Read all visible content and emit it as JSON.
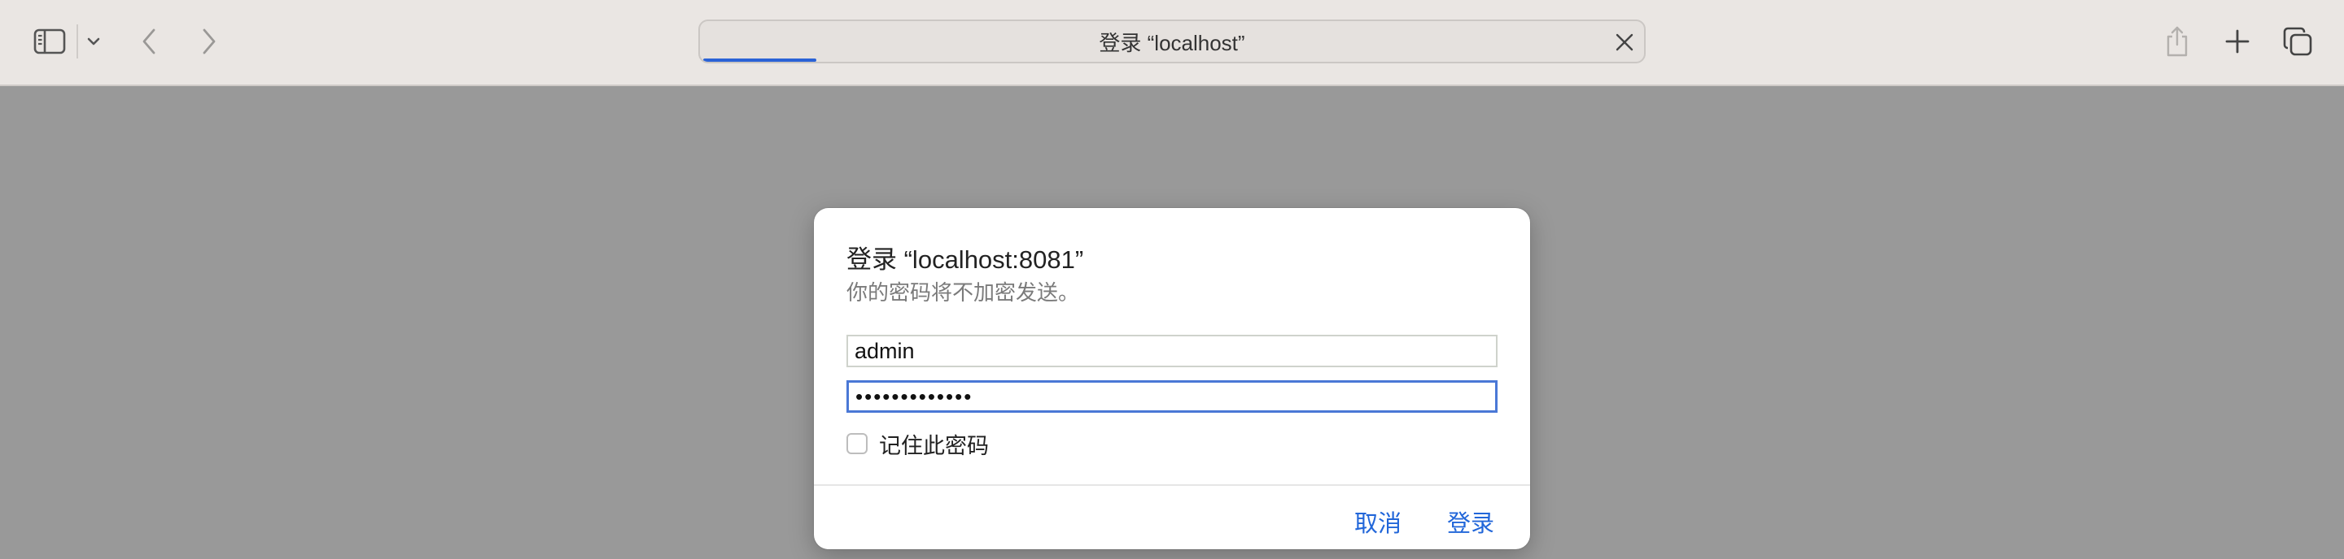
{
  "toolbar": {
    "address_text": "登录 “localhost”",
    "load_progress": 0.12,
    "icons": {
      "sidebar": "sidebar-icon",
      "sidebar_menu": "chevron-down-icon",
      "back": "chevron-left-icon",
      "forward": "chevron-right-icon",
      "close": "close-icon",
      "share": "share-icon",
      "new_tab": "plus-icon",
      "tab_overview": "tab-overview-icon"
    }
  },
  "dialog": {
    "title": "登录 “localhost:8081”",
    "subtitle": "你的密码将不加密发送。",
    "username_value": "admin",
    "password_value": "•••••••••••••",
    "remember_label": "记住此密码",
    "remember_checked": false,
    "cancel_label": "取消",
    "login_label": "登录"
  },
  "colors": {
    "accent": "#2166d9",
    "toolbar_bg": "#eae6e3",
    "page_overlay": "#999999"
  }
}
